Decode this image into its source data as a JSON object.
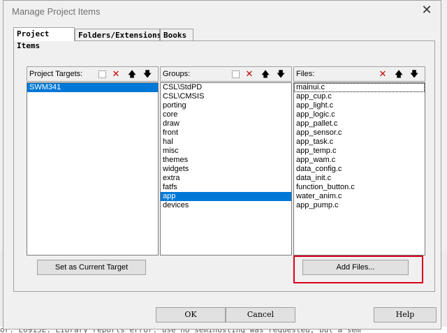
{
  "window": {
    "title": "Manage Project Items",
    "close_glyph": "✕"
  },
  "tabs": [
    {
      "label": "Project Items"
    },
    {
      "label": "Folders/Extensions"
    },
    {
      "label": "Books"
    }
  ],
  "targets": {
    "header": "Project Targets:",
    "items": [
      "SWM341"
    ]
  },
  "groups": {
    "header": "Groups:",
    "items": [
      "CSL\\StdPD",
      "CSL\\CMSIS",
      "porting",
      "core",
      "draw",
      "front",
      "hal",
      "misc",
      "themes",
      "widgets",
      "extra",
      "fatfs",
      "app",
      "devices"
    ]
  },
  "files": {
    "header": "Files:",
    "items": [
      "mainui.c",
      "app_cup.c",
      "app_light.c",
      "app_logic.c",
      "app_pallet.c",
      "app_sensor.c",
      "app_task.c",
      "app_temp.c",
      "app_wam.c",
      "data_config.c",
      "data_init.c",
      "function_button.c",
      "water_anim.c",
      "app_pump.c"
    ]
  },
  "buttons": {
    "set_current": "Set as Current Target",
    "add_files": "Add Files...",
    "ok": "OK",
    "cancel": "Cancel",
    "help": "Help"
  },
  "icons": {
    "new": "new-item-icon",
    "delete": "delete-icon",
    "up": "move-up-icon",
    "down": "move-down-icon"
  },
  "console_text": "or: L6915E: Library reports error:  use no semihosting was requested, but a sem",
  "colors": {
    "selection": "#0078d7",
    "highlight_box": "#d9001b",
    "delete_icon": "#c00000"
  }
}
